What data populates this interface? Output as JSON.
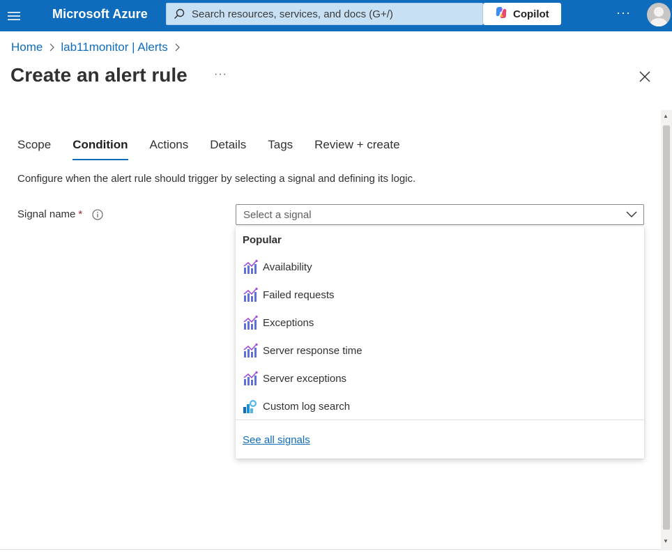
{
  "topbar": {
    "brand": "Microsoft Azure",
    "search_placeholder": "Search resources, services, and docs (G+/)",
    "copilot_label": "Copilot",
    "more_label": "···"
  },
  "breadcrumb": {
    "items": [
      "Home",
      "lab11monitor | Alerts"
    ]
  },
  "page": {
    "title": "Create an alert rule",
    "more_label": "···"
  },
  "tabs": [
    {
      "label": "Scope",
      "active": false
    },
    {
      "label": "Condition",
      "active": true
    },
    {
      "label": "Actions",
      "active": false
    },
    {
      "label": "Details",
      "active": false
    },
    {
      "label": "Tags",
      "active": false
    },
    {
      "label": "Review + create",
      "active": false
    }
  ],
  "condition": {
    "description": "Configure when the alert rule should trigger by selecting a signal and defining its logic.",
    "signal_label": "Signal name",
    "required_mark": "*",
    "select_placeholder": "Select a signal"
  },
  "dropdown": {
    "group": "Popular",
    "options": [
      {
        "label": "Availability",
        "icon": "metric-chart-icon"
      },
      {
        "label": "Failed requests",
        "icon": "metric-chart-icon"
      },
      {
        "label": "Exceptions",
        "icon": "metric-chart-icon"
      },
      {
        "label": "Server response time",
        "icon": "metric-chart-icon"
      },
      {
        "label": "Server exceptions",
        "icon": "metric-chart-icon"
      },
      {
        "label": "Custom log search",
        "icon": "log-search-icon"
      }
    ],
    "see_all": "See all signals"
  },
  "colors": {
    "topbar": "#0f6cbd",
    "accent": "#0f6cbd",
    "required": "#a4262c"
  }
}
